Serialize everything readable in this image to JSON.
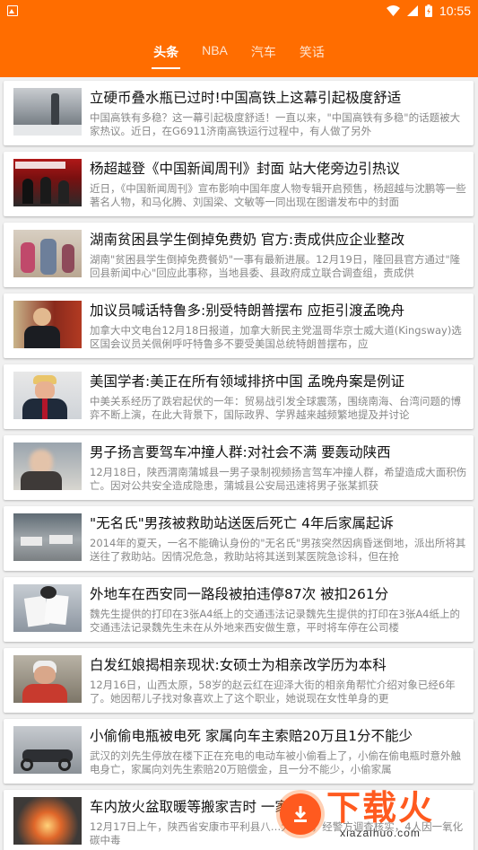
{
  "status": {
    "time": "10:55"
  },
  "tabs": [
    {
      "label": "头条",
      "active": true
    },
    {
      "label": "NBA",
      "active": false
    },
    {
      "label": "汽车",
      "active": false
    },
    {
      "label": "笑话",
      "active": false
    }
  ],
  "news": [
    {
      "title": "立硬币叠水瓶已过时!中国高铁上这幕引起极度舒适",
      "summary": "中国高铁有多稳？这一幕引起极度舒适！一直以来，\"中国高铁有多稳\"的话题被大家热议。近日，在G6911济南高铁运行过程中，有人做了另外"
    },
    {
      "title": "杨超越登《中国新闻周刊》封面 站大佬旁边引热议",
      "summary": "近日，《中国新闻周刊》宣布影响中国年度人物专辑开启预售，杨超越与沈鹏等一些著名人物，和马化腾、刘国梁、文敏等一同出现在图谱发布中的封面"
    },
    {
      "title": "湖南贫困县学生倒掉免费奶 官方:责成供应企业整改",
      "summary": "湖南\"贫困县学生倒掉免费餐奶\"一事有最新进展。12月19日，隆回县官方通过\"隆回县新闻中心\"回应此事称，当地县委、县政府成立联合调查组，责成供"
    },
    {
      "title": "加议员喊话特鲁多:别受特朗普摆布 应拒引渡孟晚舟",
      "summary": "加拿大中文电台12月18日报道，加拿大新民主党温哥华京士威大道(Kingsway)选区国会议员关佩俐呼吁特鲁多不要受美国总统特朗普摆布，应"
    },
    {
      "title": "美国学者:美正在所有领域排挤中国 孟晚舟案是例证",
      "summary": "中美关系经历了跌宕起伏的一年：贸易战引发全球震荡，围绕南海、台湾问题的博弈不断上演，在此大背景下，国际政界、学界越来越频繁地提及并讨论"
    },
    {
      "title": "男子扬言要驾车冲撞人群:对社会不满 要轰动陕西",
      "summary": "12月18日，陕西渭南蒲城县一男子录制视频扬言驾车冲撞人群，希望造成大面积伤亡。因对公共安全造成隐患，蒲城县公安局迅速将男子张某抓获"
    },
    {
      "title": "\"无名氏\"男孩被救助站送医后死亡 4年后家属起诉",
      "summary": "2014年的夏天，一名不能确认身份的\"无名氏\"男孩突然因病昏迷倒地，派出所将其送往了救助站。因情况危急，救助站将其送到某医院急诊科，但在抢"
    },
    {
      "title": "外地车在西安同一路段被拍违停87次 被扣261分",
      "summary": "魏先生提供的打印在3张A4纸上的交通违法记录魏先生提供的打印在3张A4纸上的交通违法记录魏先生未在从外地来西安做生意，平时将车停在公司楼"
    },
    {
      "title": "白发红娘揭相亲现状:女硕士为相亲改学历为本科",
      "summary": "12月16日，山西太原，58岁的赵云红在迎泽大街的相亲角帮忙介绍对象已经6年了。她因帮儿子找对象喜欢上了这个职业，她说现在女性单身的更"
    },
    {
      "title": "小偷偷电瓶被电死 家属向车主索赔20万且1分不能少",
      "summary": "武汉的刘先生停放在楼下正在充电的电动车被小偷看上了，小偷在偷电瓶时意外触电身亡，家属向刘先生索赔20万赔偿金，且一分不能少，小偷家属"
    },
    {
      "title": "车内放火盆取暖等搬家吉时 一家…",
      "summary": "12月17日上午，陕西省安康市平利县八…大事故，经警方调查核实，4人因一氧化碳中毒"
    }
  ],
  "watermark": {
    "brand": "下载火",
    "domain": "xiazaihuo.com"
  }
}
